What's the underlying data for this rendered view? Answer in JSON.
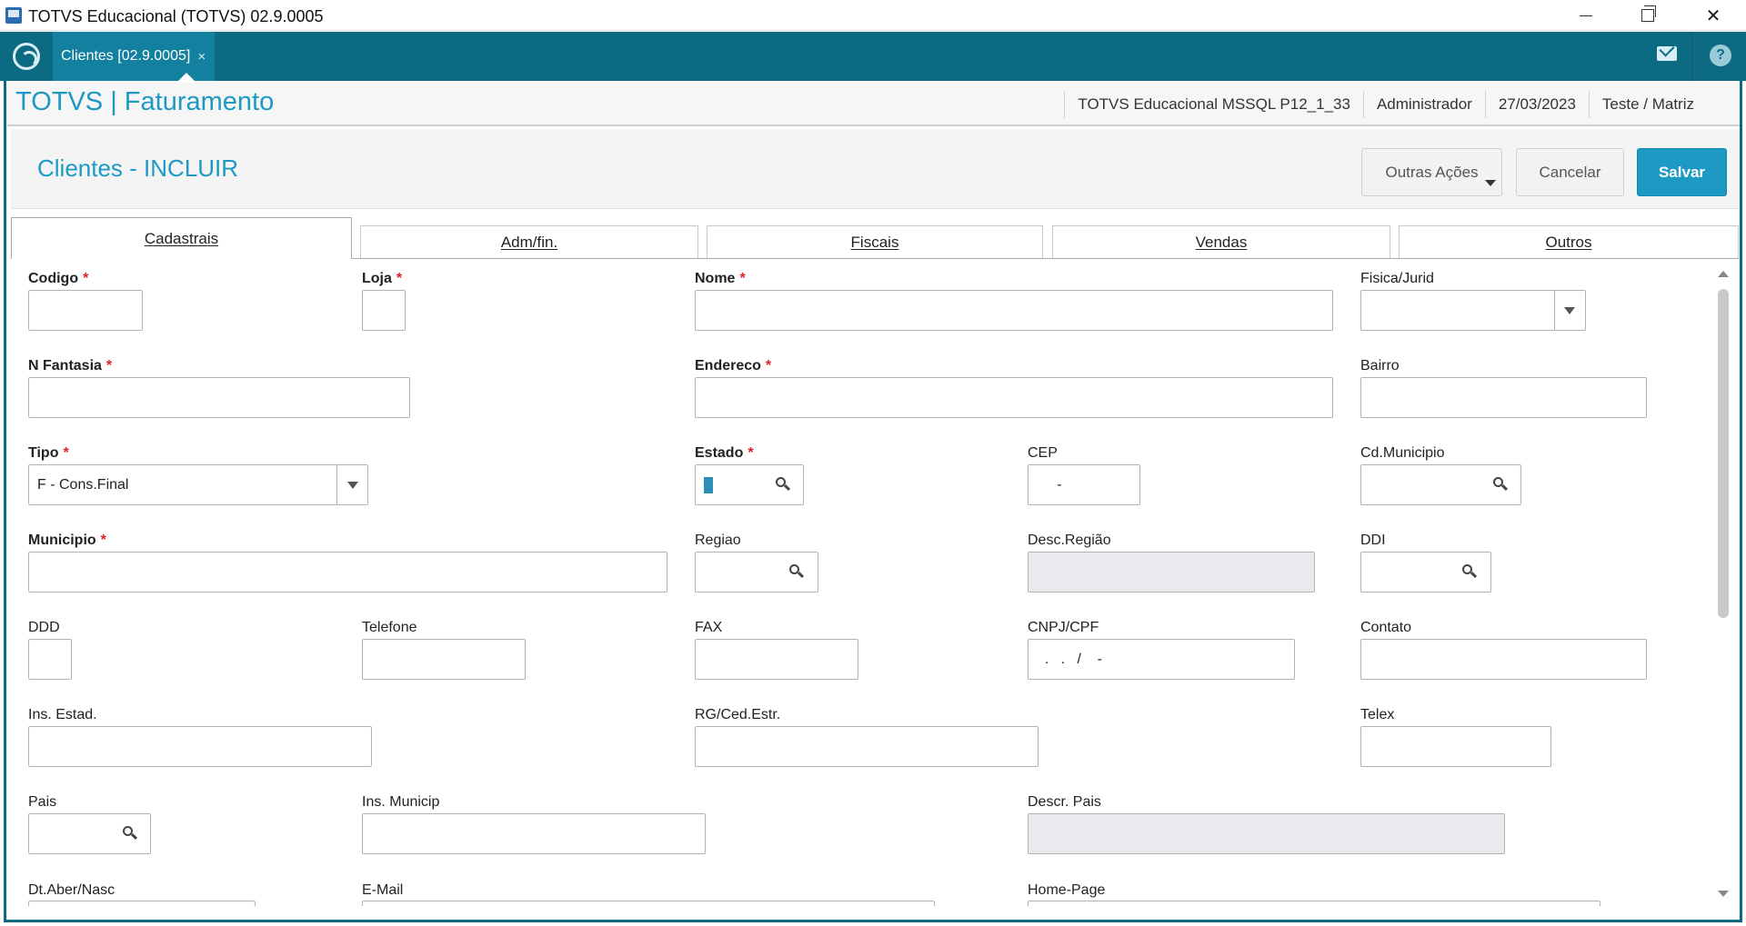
{
  "window": {
    "title": "TOTVS Educacional (TOTVS) 02.9.0005"
  },
  "topbar": {
    "tab_label": "Clientes [02.9.0005]",
    "tab_close": "×"
  },
  "module": {
    "title": "TOTVS | Faturamento",
    "environment": "TOTVS Educacional MSSQL P12_1_33",
    "user": "Administrador",
    "date": "27/03/2023",
    "branch": "Teste / Matriz"
  },
  "page": {
    "title": "Clientes - INCLUIR",
    "buttons": {
      "outras": "Outras Ações",
      "cancelar": "Cancelar",
      "salvar": "Salvar"
    }
  },
  "tabs": [
    "Cadastrais",
    "Adm/fin.",
    "Fiscais",
    "Vendas",
    "Outros"
  ],
  "form": {
    "codigo": {
      "label": "Codigo",
      "value": ""
    },
    "loja": {
      "label": "Loja",
      "value": ""
    },
    "nome": {
      "label": "Nome",
      "value": ""
    },
    "fisica_jurid": {
      "label": "Fisica/Jurid",
      "value": ""
    },
    "n_fantasia": {
      "label": "N Fantasia",
      "value": ""
    },
    "endereco": {
      "label": "Endereco",
      "value": ""
    },
    "bairro": {
      "label": "Bairro",
      "value": ""
    },
    "tipo": {
      "label": "Tipo",
      "value": "F - Cons.Final"
    },
    "estado": {
      "label": "Estado",
      "value": ""
    },
    "cep": {
      "label": "CEP",
      "value": "     -"
    },
    "cd_municipio": {
      "label": "Cd.Municipio",
      "value": ""
    },
    "municipio": {
      "label": "Municipio",
      "value": ""
    },
    "regiao": {
      "label": "Regiao",
      "value": ""
    },
    "desc_regiao": {
      "label": "Desc.Região",
      "value": ""
    },
    "ddi": {
      "label": "DDI",
      "value": ""
    },
    "ddd": {
      "label": "DDD",
      "value": ""
    },
    "telefone": {
      "label": "Telefone",
      "value": ""
    },
    "fax": {
      "label": "FAX",
      "value": ""
    },
    "cnpj_cpf": {
      "label": "CNPJ/CPF",
      "value": "  .   .   /    -"
    },
    "contato": {
      "label": "Contato",
      "value": ""
    },
    "ins_estad": {
      "label": "Ins. Estad.",
      "value": ""
    },
    "rg_ced_estr": {
      "label": "RG/Ced.Estr.",
      "value": ""
    },
    "telex": {
      "label": "Telex",
      "value": ""
    },
    "pais": {
      "label": "Pais",
      "value": ""
    },
    "ins_municip": {
      "label": "Ins. Municip",
      "value": ""
    },
    "descr_pais": {
      "label": "Descr. Pais",
      "value": ""
    },
    "dt_aber_nasc": {
      "label": "Dt.Aber/Nasc",
      "value": ""
    },
    "email": {
      "label": "E-Mail",
      "value": ""
    },
    "home_page": {
      "label": "Home-Page",
      "value": ""
    }
  },
  "required_marker": "*",
  "colors": {
    "accent": "#1d9ac4",
    "topbar": "#0c6a83",
    "required": "#e02020"
  }
}
